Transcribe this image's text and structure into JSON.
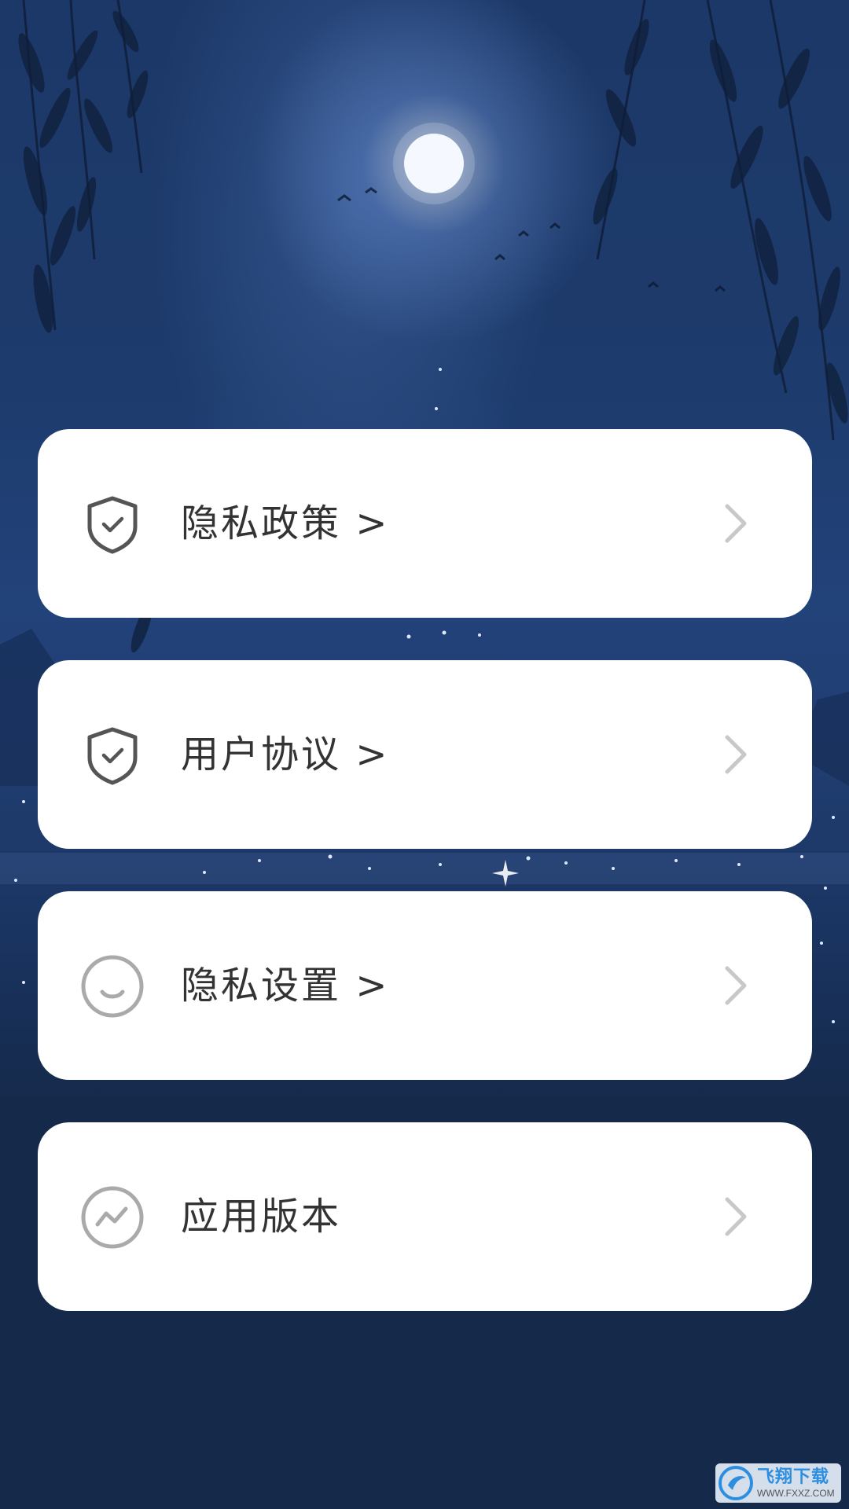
{
  "menu": {
    "items": [
      {
        "label": "隐私政策 >",
        "icon": "shield-check-icon"
      },
      {
        "label": "用户协议 >",
        "icon": "shield-check-icon"
      },
      {
        "label": "隐私设置 >",
        "icon": "smile-circle-icon"
      },
      {
        "label": "应用版本",
        "icon": "trend-circle-icon"
      }
    ],
    "chevron_icon": "chevron-right-icon"
  },
  "watermark": {
    "title": "飞翔下载",
    "url": "WWW.FXXZ.COM"
  },
  "colors": {
    "background_navy": "#152a4b",
    "card": "#ffffff",
    "label_text": "#333333",
    "icon_gray": "#555555",
    "icon_light_gray": "#aaaaaa",
    "chevron_gray": "#c8c8c8",
    "watermark_blue": "#2d8ee0"
  }
}
